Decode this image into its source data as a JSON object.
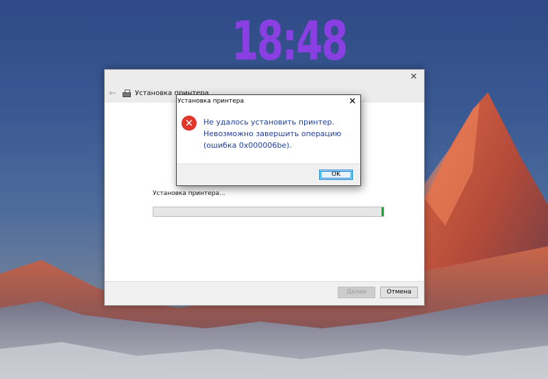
{
  "desktop": {
    "clock": "18:48"
  },
  "wizard": {
    "title": "Установка принтера",
    "progress_label": "Установка принтера...",
    "progress_fraction": 1.0,
    "next_label": "Далее",
    "cancel_label": "Отмена"
  },
  "dialog": {
    "title": "Установка принтера",
    "message_lines": [
      "Не удалось установить принтер.",
      "Невозможно завершить операцию",
      "(ошибка 0x000006be)."
    ],
    "ok_label": "OK"
  },
  "colors": {
    "clock": "#8a3fe3",
    "error_icon": "#e0362c",
    "message_text": "#1f3fa0",
    "progress_marker": "#06b025",
    "focus_border": "#0078d7"
  }
}
